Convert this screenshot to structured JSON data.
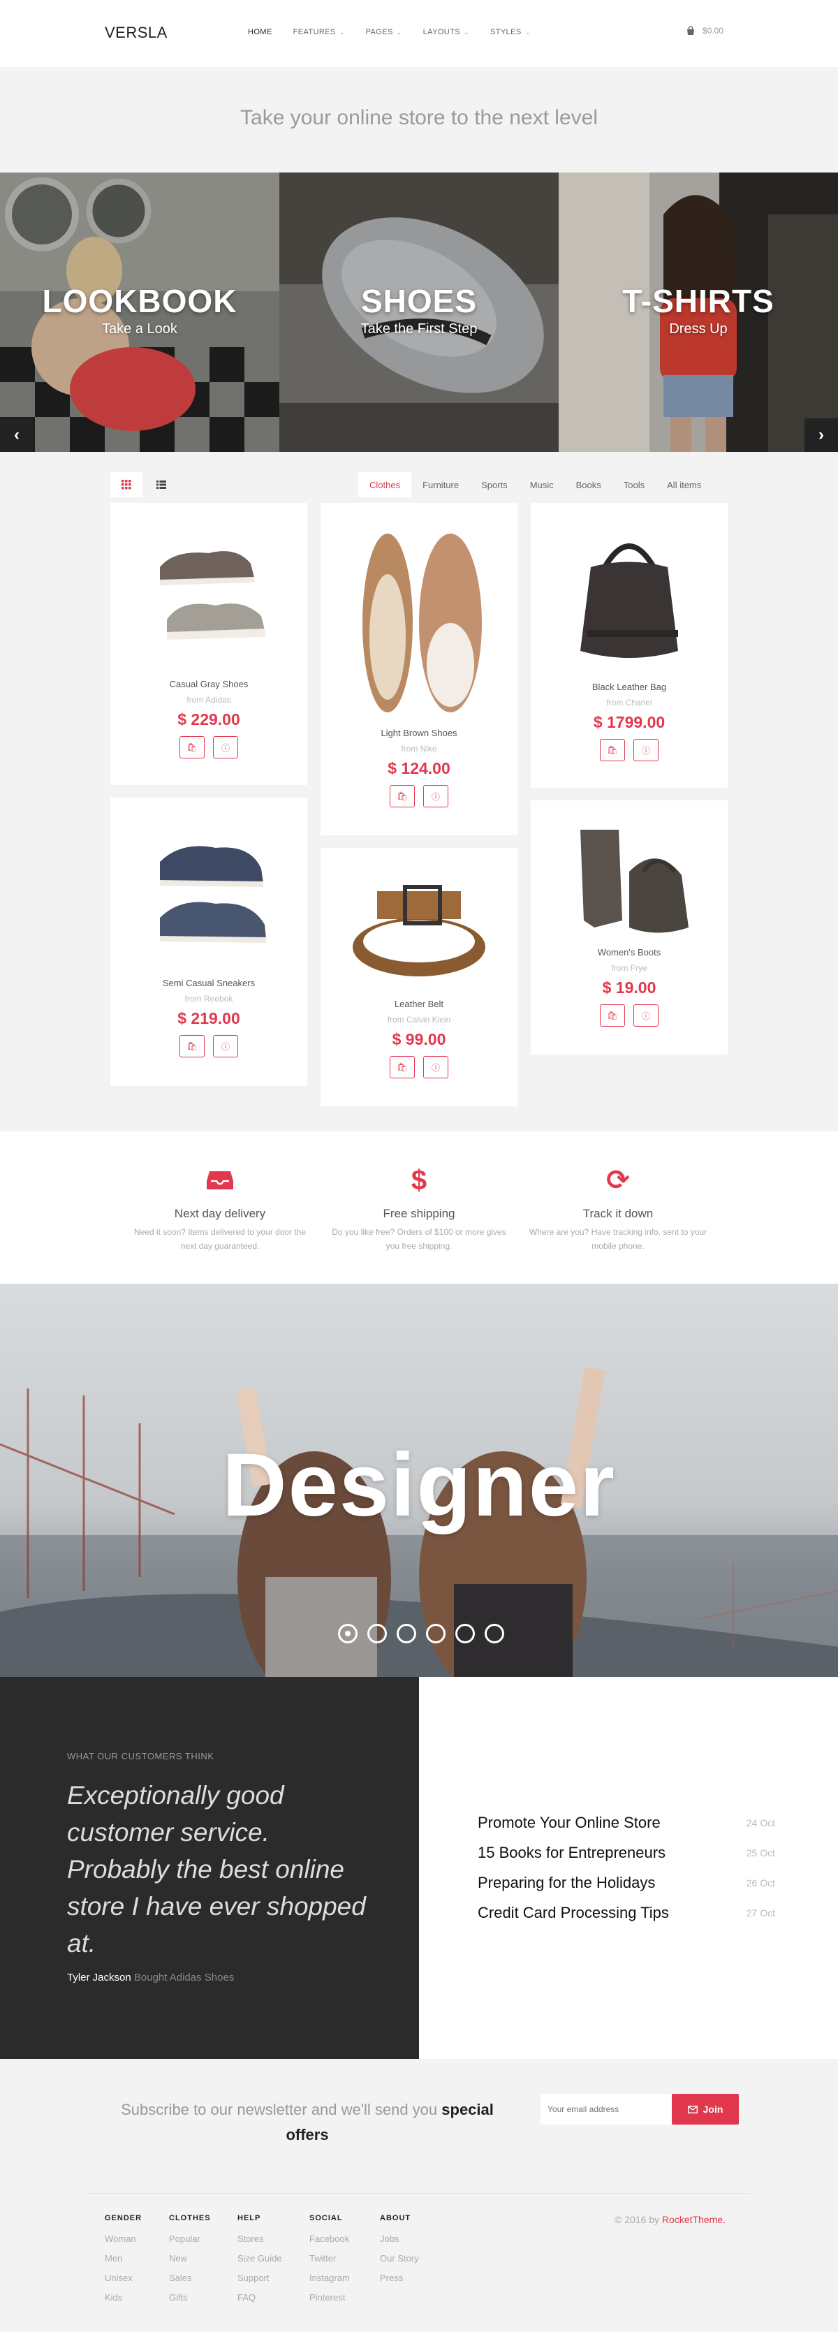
{
  "header": {
    "logo": "VERSLA",
    "nav": [
      {
        "label": "HOME",
        "dropdown": false
      },
      {
        "label": "FEATURES",
        "dropdown": true
      },
      {
        "label": "PAGES",
        "dropdown": true
      },
      {
        "label": "LAYOUTS",
        "dropdown": true
      },
      {
        "label": "STYLES",
        "dropdown": true
      }
    ],
    "cart_total": "$0.00"
  },
  "hero": {
    "tagline": "Take your online store to the next level"
  },
  "slider": {
    "slides": [
      {
        "title": "LOOKBOOK",
        "subtitle": "Take a Look"
      },
      {
        "title": "SHOES",
        "subtitle": "Take the First Step"
      },
      {
        "title": "T-SHIRTS",
        "subtitle": "Dress Up"
      }
    ],
    "prev_icon": "chevron-left-icon",
    "next_icon": "chevron-right-icon"
  },
  "filters": {
    "view_modes": [
      "grid-view-icon",
      "list-view-icon"
    ],
    "categories": [
      "Clothes",
      "Furniture",
      "Sports",
      "Music",
      "Books",
      "Tools",
      "All items"
    ],
    "active": "Clothes"
  },
  "products": [
    {
      "name": "Casual Gray Shoes",
      "brand": "from Adidas",
      "price": "$ 229.00"
    },
    {
      "name": "Light Brown Shoes",
      "brand": "from Nike",
      "price": "$ 124.00"
    },
    {
      "name": "Black Leather Bag",
      "brand": "from Chanel",
      "price": "$ 1799.00"
    },
    {
      "name": "Semi Casual Sneakers",
      "brand": "from Reebok",
      "price": "$ 219.00"
    },
    {
      "name": "Leather Belt",
      "brand": "from Calvin Klein",
      "price": "$ 99.00"
    },
    {
      "name": "Women's Boots",
      "brand": "from Frye",
      "price": "$ 19.00"
    }
  ],
  "features": [
    {
      "icon": "inbox-icon",
      "title": "Next day delivery",
      "desc": "Need it soon? Items delivered to your door the next day guaranteed."
    },
    {
      "icon": "dollar-icon",
      "title": "Free shipping",
      "desc": "Do you like free? Orders of $100 or more gives you free shipping."
    },
    {
      "icon": "refresh-icon",
      "title": "Track it down",
      "desc": "Where are you? Have tracking info. sent to your mobile phone."
    }
  ],
  "designer": {
    "title": "Designer",
    "dot_count": 6,
    "active_dot": 1
  },
  "testimonial": {
    "label": "WHAT OUR CUSTOMERS THINK",
    "quote": "Exceptionally good customer service. Probably the best online store I have ever shopped at.",
    "author": "Tyler Jackson",
    "note": "Bought Adidas Shoes"
  },
  "blog": [
    {
      "title": "Promote Your Online Store",
      "date": "24 Oct"
    },
    {
      "title": "15 Books for Entrepreneurs",
      "date": "25 Oct"
    },
    {
      "title": "Preparing for the Holidays",
      "date": "26 Oct"
    },
    {
      "title": "Credit Card Processing Tips",
      "date": "27 Oct"
    }
  ],
  "newsletter": {
    "text": "Subscribe to our newsletter and we'll send you",
    "emphasis": "special offers",
    "placeholder": "Your email address",
    "button": "Join"
  },
  "footer": {
    "columns": [
      {
        "heading": "GENDER",
        "items": [
          "Woman",
          "Men",
          "Unisex",
          "Kids"
        ]
      },
      {
        "heading": "CLOTHES",
        "items": [
          "Popular",
          "New",
          "Sales",
          "Gifts"
        ]
      },
      {
        "heading": "HELP",
        "items": [
          "Stores",
          "Size Guide",
          "Support",
          "FAQ"
        ]
      },
      {
        "heading": "SOCIAL",
        "items": [
          "Facebook",
          "Twitter",
          "Instagram",
          "Pinterest"
        ]
      },
      {
        "heading": "ABOUT",
        "items": [
          "Jobs",
          "Our Story",
          "Press"
        ]
      }
    ],
    "copyright": "© 2016 by",
    "brand": "RocketTheme."
  },
  "colors": {
    "accent": "#e2384d",
    "dark": "#2b2b2b",
    "background": "#f3f3f3"
  }
}
